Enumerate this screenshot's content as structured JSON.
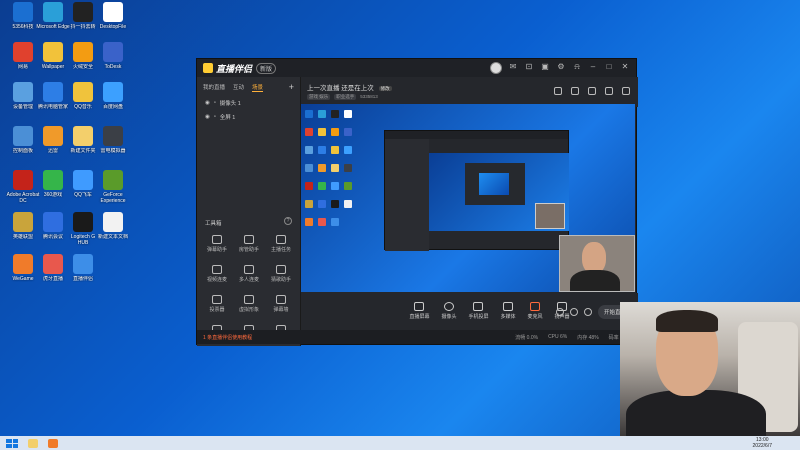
{
  "desktop": {
    "icons": [
      {
        "label": "5356科技",
        "color": "#1b6fd1"
      },
      {
        "label": "Microsoft Edge",
        "color": "#2a9fd8"
      },
      {
        "label": "抖一抖去转",
        "color": "#222222"
      },
      {
        "label": "DesktopFile",
        "color": "#ffffff"
      },
      {
        "label": "网易",
        "color": "#e0412e"
      },
      {
        "label": "Wallpaper",
        "color": "#f2c23a"
      },
      {
        "label": "火绒安全",
        "color": "#f39c12"
      },
      {
        "label": "ToDesk",
        "color": "#3a62c9"
      },
      {
        "label": "设备管理",
        "color": "#5aa0e0"
      },
      {
        "label": "腾讯电脑管家",
        "color": "#2d7ee6"
      },
      {
        "label": "QQ音乐",
        "color": "#f0c33c"
      },
      {
        "label": "百度网盘",
        "color": "#3ca0ff"
      },
      {
        "label": "控制面板",
        "color": "#4b8fd6"
      },
      {
        "label": "迅雷",
        "color": "#f09a2a"
      },
      {
        "label": "新建文件夹",
        "color": "#f3cf6b"
      },
      {
        "label": "雷电模拟器",
        "color": "#3b3f46"
      },
      {
        "label": "Adobe Acrobat DC",
        "color": "#c4231a"
      },
      {
        "label": "360游戏",
        "color": "#35b54a"
      },
      {
        "label": "QQ飞车",
        "color": "#3f9bff"
      },
      {
        "label": "GeForce Experience",
        "color": "#5a9b2a"
      },
      {
        "label": "英雄联盟",
        "color": "#c9a43b"
      },
      {
        "label": "腾讯会议",
        "color": "#2f6ee0"
      },
      {
        "label": "Logitech G HUB",
        "color": "#1a1a1a"
      },
      {
        "label": "新建文本文档",
        "color": "#f2f2f2"
      },
      {
        "label": "WeGame",
        "color": "#f07b2a"
      },
      {
        "label": "虎牙直播",
        "color": "#e8584d"
      },
      {
        "label": "直播伴侣",
        "color": "#3d8ee8"
      }
    ]
  },
  "app": {
    "name": "直播伴侣",
    "version": "新版",
    "left_tabs": [
      "我的直播",
      "互动",
      "场景"
    ],
    "active_tab": "场景",
    "scenes": [
      {
        "label": "摄像头 1"
      },
      {
        "label": "全屏 1"
      }
    ],
    "tools_title": "工具箱",
    "tools": [
      {
        "label": "弹幕助手",
        "icon": "comment-icon"
      },
      {
        "label": "房管助手",
        "icon": "shield-icon"
      },
      {
        "label": "主播任务",
        "icon": "task-icon"
      },
      {
        "label": "视频连麦",
        "icon": "video-icon"
      },
      {
        "label": "多人连麦",
        "icon": "people-icon"
      },
      {
        "label": "猜歌助手",
        "icon": "music-icon"
      },
      {
        "label": "投票器",
        "icon": "vote-icon"
      },
      {
        "label": "虚拟形象",
        "icon": "avatar-icon"
      },
      {
        "label": "弹幕墙",
        "icon": "wall-icon"
      },
      {
        "label": "画中画",
        "icon": "pip-icon"
      },
      {
        "label": "抽奖",
        "icon": "gift-icon"
      },
      {
        "label": "更多",
        "icon": "more-icon"
      }
    ],
    "header": {
      "title": "上一次直播 还是在上次",
      "chip": "修改",
      "sub": [
        "游戏 娱乐",
        "职业选手",
        "5335813"
      ]
    },
    "bottom_tools": [
      {
        "label": "直播屏幕"
      },
      {
        "label": "摄像头"
      },
      {
        "label": "手机投屏"
      },
      {
        "label": "多媒体"
      },
      {
        "label": "麦克风"
      },
      {
        "label": "扬声器"
      }
    ],
    "start_button": "开始直播",
    "status": {
      "warn": "1 条直播伴侣使用教程",
      "metrics": [
        "流畅 0.0%",
        "CPU 6%",
        "内存 48%",
        "码率 0kb/s"
      ]
    }
  },
  "taskbar": {
    "time": "13:00",
    "date": "2022/6/7"
  }
}
